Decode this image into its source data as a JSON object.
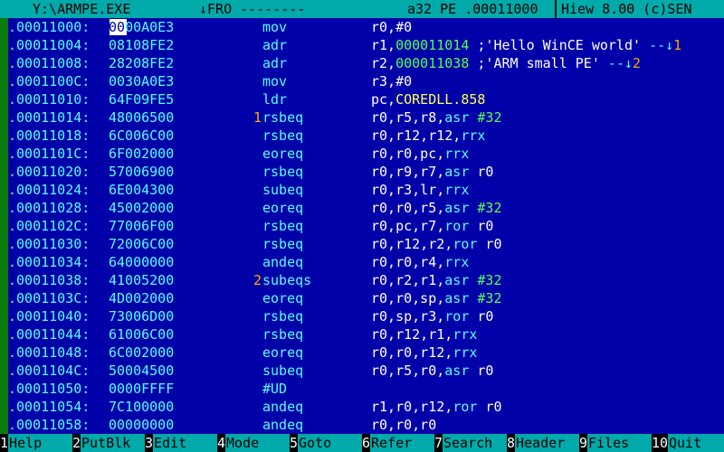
{
  "titlebar": {
    "file": "Y:\\ARMPE.EXE",
    "mode": "↓FRO --------",
    "info": "a32 PE .00011000",
    "version": "Hiew 8.00 (c)SEN"
  },
  "rows": [
    {
      "addr": ".00011000:",
      "hex": "0000A0E3",
      "ref": "",
      "mnem": "mov",
      "op": [
        {
          "t": "r0,#0",
          "c": "txt"
        }
      ]
    },
    {
      "addr": ".00011004:",
      "hex": "08108FE2",
      "ref": "",
      "mnem": "adr",
      "op": [
        {
          "t": "r1,",
          "c": "txt"
        },
        {
          "t": "000011014",
          "c": "num"
        },
        {
          "t": " ;'Hello WinCE world' ",
          "c": "str"
        },
        {
          "t": "--↓",
          "c": "nav"
        },
        {
          "t": "1",
          "c": "nnum"
        }
      ]
    },
    {
      "addr": ".00011008:",
      "hex": "28208FE2",
      "ref": "",
      "mnem": "adr",
      "op": [
        {
          "t": "r2,",
          "c": "txt"
        },
        {
          "t": "000011038",
          "c": "num"
        },
        {
          "t": " ;'ARM small PE' ",
          "c": "str"
        },
        {
          "t": "--↓",
          "c": "nav"
        },
        {
          "t": "2",
          "c": "nnum"
        }
      ]
    },
    {
      "addr": ".0001100C:",
      "hex": "0030A0E3",
      "ref": "",
      "mnem": "mov",
      "op": [
        {
          "t": "r3,#0",
          "c": "txt"
        }
      ]
    },
    {
      "addr": ".00011010:",
      "hex": "64F09FE5",
      "ref": "",
      "mnem": "ldr",
      "op": [
        {
          "t": "pc,",
          "c": "txt"
        },
        {
          "t": "COREDLL.858",
          "c": "yel"
        }
      ]
    },
    {
      "addr": ".00011014:",
      "hex": "48006500",
      "ref": "1",
      "mnem": "rsbeq",
      "op": [
        {
          "t": "r0,r5,r8,",
          "c": "txt"
        },
        {
          "t": "asr",
          "c": "kw"
        },
        {
          "t": " ",
          "c": "txt"
        },
        {
          "t": "#32",
          "c": "num"
        }
      ]
    },
    {
      "addr": ".00011018:",
      "hex": "6C006C00",
      "ref": "",
      "mnem": "rsbeq",
      "op": [
        {
          "t": "r0,r12,r12,",
          "c": "txt"
        },
        {
          "t": "rrx",
          "c": "kw"
        }
      ]
    },
    {
      "addr": ".0001101C:",
      "hex": "6F002000",
      "ref": "",
      "mnem": "eoreq",
      "op": [
        {
          "t": "r0,r0,pc,",
          "c": "txt"
        },
        {
          "t": "rrx",
          "c": "kw"
        }
      ]
    },
    {
      "addr": ".00011020:",
      "hex": "57006900",
      "ref": "",
      "mnem": "rsbeq",
      "op": [
        {
          "t": "r0,r9,r7,",
          "c": "txt"
        },
        {
          "t": "asr",
          "c": "kw"
        },
        {
          "t": " r0",
          "c": "txt"
        }
      ]
    },
    {
      "addr": ".00011024:",
      "hex": "6E004300",
      "ref": "",
      "mnem": "subeq",
      "op": [
        {
          "t": "r0,r3,lr,",
          "c": "txt"
        },
        {
          "t": "rrx",
          "c": "kw"
        }
      ]
    },
    {
      "addr": ".00011028:",
      "hex": "45002000",
      "ref": "",
      "mnem": "eoreq",
      "op": [
        {
          "t": "r0,r0,r5,",
          "c": "txt"
        },
        {
          "t": "asr",
          "c": "kw"
        },
        {
          "t": " ",
          "c": "txt"
        },
        {
          "t": "#32",
          "c": "num"
        }
      ]
    },
    {
      "addr": ".0001102C:",
      "hex": "77006F00",
      "ref": "",
      "mnem": "rsbeq",
      "op": [
        {
          "t": "r0,pc,r7,",
          "c": "txt"
        },
        {
          "t": "ror",
          "c": "kw"
        },
        {
          "t": " r0",
          "c": "txt"
        }
      ]
    },
    {
      "addr": ".00011030:",
      "hex": "72006C00",
      "ref": "",
      "mnem": "rsbeq",
      "op": [
        {
          "t": "r0,r12,r2,",
          "c": "txt"
        },
        {
          "t": "ror",
          "c": "kw"
        },
        {
          "t": " r0",
          "c": "txt"
        }
      ]
    },
    {
      "addr": ".00011034:",
      "hex": "64000000",
      "ref": "",
      "mnem": "andeq",
      "op": [
        {
          "t": "r0,r0,r4,",
          "c": "txt"
        },
        {
          "t": "rrx",
          "c": "kw"
        }
      ]
    },
    {
      "addr": ".00011038:",
      "hex": "41005200",
      "ref": "2",
      "mnem": "subeqs",
      "op": [
        {
          "t": "r0,r2,r1,",
          "c": "txt"
        },
        {
          "t": "asr",
          "c": "kw"
        },
        {
          "t": " ",
          "c": "txt"
        },
        {
          "t": "#32",
          "c": "num"
        }
      ]
    },
    {
      "addr": ".0001103C:",
      "hex": "4D002000",
      "ref": "",
      "mnem": "eoreq",
      "op": [
        {
          "t": "r0,r0,sp,",
          "c": "txt"
        },
        {
          "t": "asr",
          "c": "kw"
        },
        {
          "t": " ",
          "c": "txt"
        },
        {
          "t": "#32",
          "c": "num"
        }
      ]
    },
    {
      "addr": ".00011040:",
      "hex": "73006D00",
      "ref": "",
      "mnem": "rsbeq",
      "op": [
        {
          "t": "r0,sp,r3,",
          "c": "txt"
        },
        {
          "t": "ror",
          "c": "kw"
        },
        {
          "t": " r0",
          "c": "txt"
        }
      ]
    },
    {
      "addr": ".00011044:",
      "hex": "61006C00",
      "ref": "",
      "mnem": "rsbeq",
      "op": [
        {
          "t": "r0,r12,r1,",
          "c": "txt"
        },
        {
          "t": "rrx",
          "c": "kw"
        }
      ]
    },
    {
      "addr": ".00011048:",
      "hex": "6C002000",
      "ref": "",
      "mnem": "eoreq",
      "op": [
        {
          "t": "r0,r0,r12,",
          "c": "txt"
        },
        {
          "t": "rrx",
          "c": "kw"
        }
      ]
    },
    {
      "addr": ".0001104C:",
      "hex": "50004500",
      "ref": "",
      "mnem": "subeq",
      "op": [
        {
          "t": "r0,r5,r0,",
          "c": "txt"
        },
        {
          "t": "asr",
          "c": "kw"
        },
        {
          "t": " r0",
          "c": "txt"
        }
      ]
    },
    {
      "addr": ".00011050:",
      "hex": "0000FFFF",
      "ref": "",
      "mnem": "#UD",
      "op": []
    },
    {
      "addr": ".00011054:",
      "hex": "7C100000",
      "ref": "",
      "mnem": "andeq",
      "op": [
        {
          "t": "r1,r0,r12,",
          "c": "txt"
        },
        {
          "t": "ror",
          "c": "kw"
        },
        {
          "t": " r0",
          "c": "txt"
        }
      ]
    },
    {
      "addr": ".00011058:",
      "hex": "00000000",
      "ref": "",
      "mnem": "andeq",
      "op": [
        {
          "t": "r0,r0,r0",
          "c": "txt"
        }
      ]
    }
  ],
  "footer": [
    {
      "num": "1",
      "label": "Help"
    },
    {
      "num": "2",
      "label": "PutBlk"
    },
    {
      "num": "3",
      "label": "Edit"
    },
    {
      "num": "4",
      "label": "Mode"
    },
    {
      "num": "5",
      "label": "Goto"
    },
    {
      "num": "6",
      "label": "Refer"
    },
    {
      "num": "7",
      "label": "Search"
    },
    {
      "num": "8",
      "label": "Header"
    },
    {
      "num": "9",
      "label": "Files"
    },
    {
      "num": "10",
      "label": "Quit"
    }
  ],
  "colors": {
    "background": "#0000a8",
    "bar": "#00aaaa",
    "address": "#55ffff",
    "number": "#55ff55",
    "import": "#ffff55",
    "reference": "#ffaa00"
  }
}
